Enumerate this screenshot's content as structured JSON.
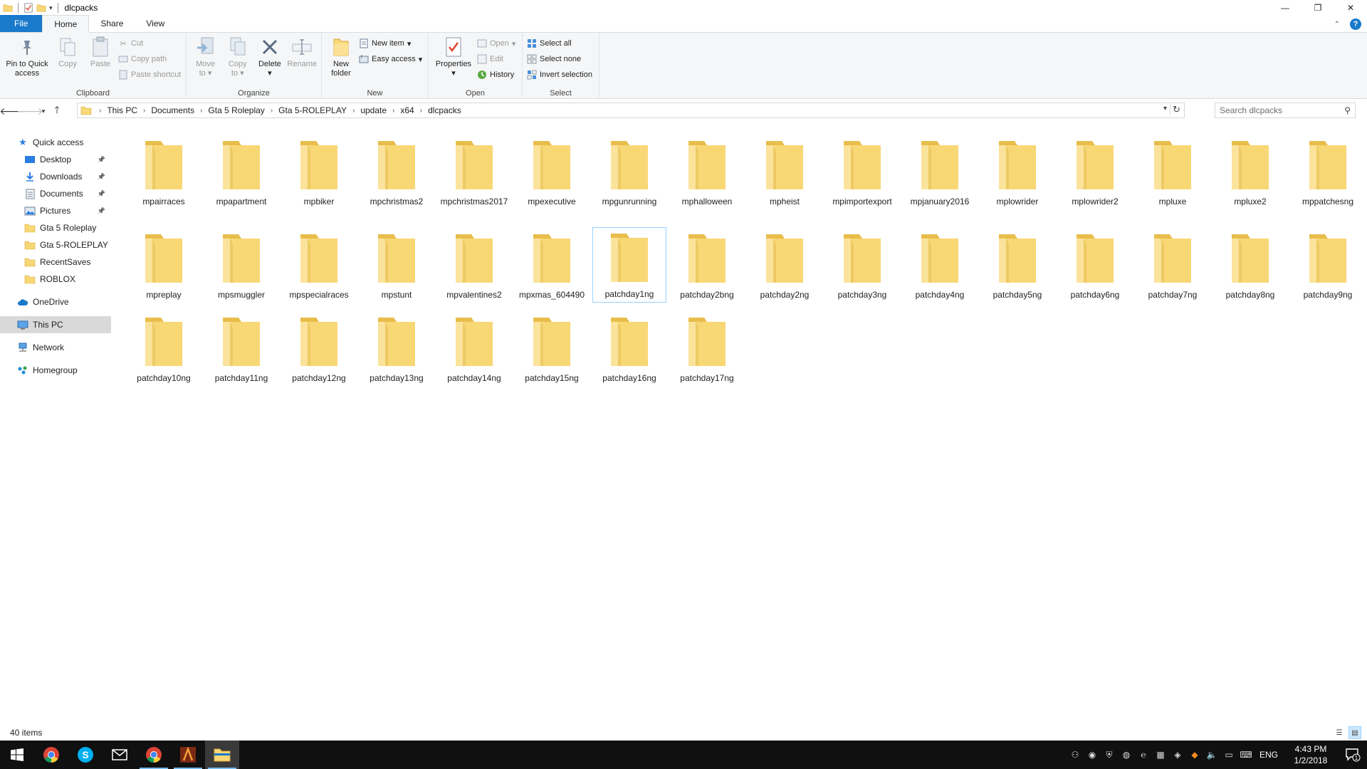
{
  "window": {
    "title": "dlcpacks",
    "controls": {
      "minimize": "—",
      "maximize": "❐",
      "close": "✕"
    }
  },
  "ribbon_tabs": [
    {
      "label": "File"
    },
    {
      "label": "Home"
    },
    {
      "label": "Share"
    },
    {
      "label": "View"
    }
  ],
  "ribbon": {
    "clipboard": {
      "label": "Clipboard",
      "pin": "Pin to Quick access",
      "pin_l1": "Pin to Quick",
      "pin_l2": "access",
      "copy": "Copy",
      "paste": "Paste",
      "cut": "Cut",
      "copy_path": "Copy path",
      "paste_shortcut": "Paste shortcut"
    },
    "organize": {
      "label": "Organize",
      "move_l1": "Move",
      "move_l2": "to",
      "copy_l1": "Copy",
      "copy_l2": "to",
      "delete": "Delete",
      "rename": "Rename"
    },
    "new": {
      "label": "New",
      "folder_l1": "New",
      "folder_l2": "folder",
      "new_item": "New item",
      "easy_access": "Easy access"
    },
    "open": {
      "label": "Open",
      "properties": "Properties",
      "open": "Open",
      "edit": "Edit",
      "history": "History"
    },
    "select": {
      "label": "Select",
      "select_all": "Select all",
      "select_none": "Select none",
      "invert": "Invert selection"
    }
  },
  "address": {
    "crumbs": [
      "This PC",
      "Documents",
      "Gta 5 Roleplay",
      "Gta 5-ROLEPLAY",
      "update",
      "x64",
      "dlcpacks"
    ],
    "search_placeholder": "Search dlcpacks"
  },
  "nav": {
    "quick_access": "Quick access",
    "quick_items": [
      {
        "label": "Desktop",
        "pinned": true,
        "icon": "desktop-icon"
      },
      {
        "label": "Downloads",
        "pinned": true,
        "icon": "downloads-icon"
      },
      {
        "label": "Documents",
        "pinned": true,
        "icon": "documents-icon"
      },
      {
        "label": "Pictures",
        "pinned": true,
        "icon": "pictures-icon"
      },
      {
        "label": "Gta 5 Roleplay",
        "pinned": false,
        "icon": "folder-icon"
      },
      {
        "label": "Gta 5-ROLEPLAY",
        "pinned": false,
        "icon": "folder-icon"
      },
      {
        "label": "RecentSaves",
        "pinned": false,
        "icon": "folder-icon"
      },
      {
        "label": "ROBLOX",
        "pinned": false,
        "icon": "folder-icon"
      }
    ],
    "onedrive": "OneDrive",
    "this_pc": "This PC",
    "network": "Network",
    "homegroup": "Homegroup"
  },
  "folders": [
    "mpairraces",
    "mpapartment",
    "mpbiker",
    "mpchristmas2",
    "mpchristmas2017",
    "mpexecutive",
    "mpgunrunning",
    "mphalloween",
    "mpheist",
    "mpimportexport",
    "mpjanuary2016",
    "mplowrider",
    "mplowrider2",
    "mpluxe",
    "mpluxe2",
    "mppatchesng",
    "mpreplay",
    "mpsmuggler",
    "mpspecialraces",
    "mpstunt",
    "mpvalentines2",
    "mpxmas_604490",
    "patchday1ng",
    "patchday2bng",
    "patchday2ng",
    "patchday3ng",
    "patchday4ng",
    "patchday5ng",
    "patchday6ng",
    "patchday7ng",
    "patchday8ng",
    "patchday9ng",
    "patchday10ng",
    "patchday11ng",
    "patchday12ng",
    "patchday13ng",
    "patchday14ng",
    "patchday15ng",
    "patchday16ng",
    "patchday17ng"
  ],
  "focused_folder": "patchday1ng",
  "status": {
    "items": "40 items"
  },
  "taskbar": {
    "time": "4:43 PM",
    "date": "1/2/2018",
    "lang": "ENG",
    "notification_count": "1"
  },
  "colors": {
    "accent": "#1979ca",
    "folder": "#f8d775",
    "folder_dark": "#e8bd4b",
    "selection": "#cce8ff"
  }
}
